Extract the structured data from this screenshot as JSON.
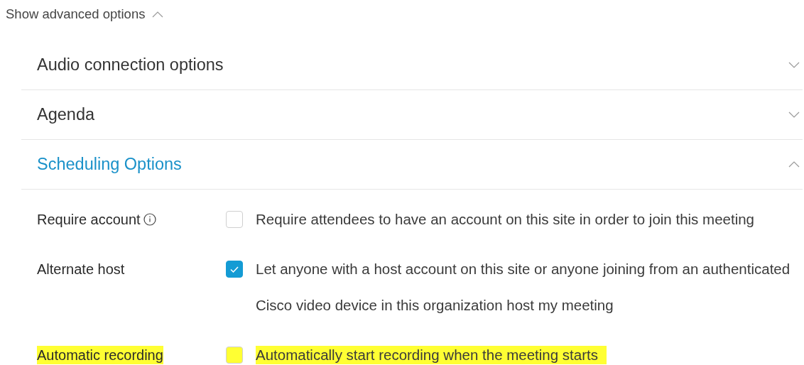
{
  "advanced_toggle": {
    "label": "Show advanced options",
    "expanded": true
  },
  "sections": [
    {
      "title": "Audio connection options",
      "expanded": false
    },
    {
      "title": "Agenda",
      "expanded": false
    },
    {
      "title": "Scheduling Options",
      "expanded": true
    }
  ],
  "options": [
    {
      "label": "Require account",
      "info": true,
      "checked": false,
      "highlighted": false,
      "lines": [
        "Require attendees to have an account on this site in order to join this meeting"
      ]
    },
    {
      "label": "Alternate host",
      "info": false,
      "checked": true,
      "highlighted": false,
      "lines": [
        "Let anyone with a host account on this site or anyone joining from an authenticated",
        "Cisco video device in this organization host my meeting"
      ]
    },
    {
      "label": "Automatic recording",
      "info": false,
      "checked": false,
      "highlighted": true,
      "lines": [
        "Automatically start recording when the meeting starts"
      ]
    }
  ]
}
